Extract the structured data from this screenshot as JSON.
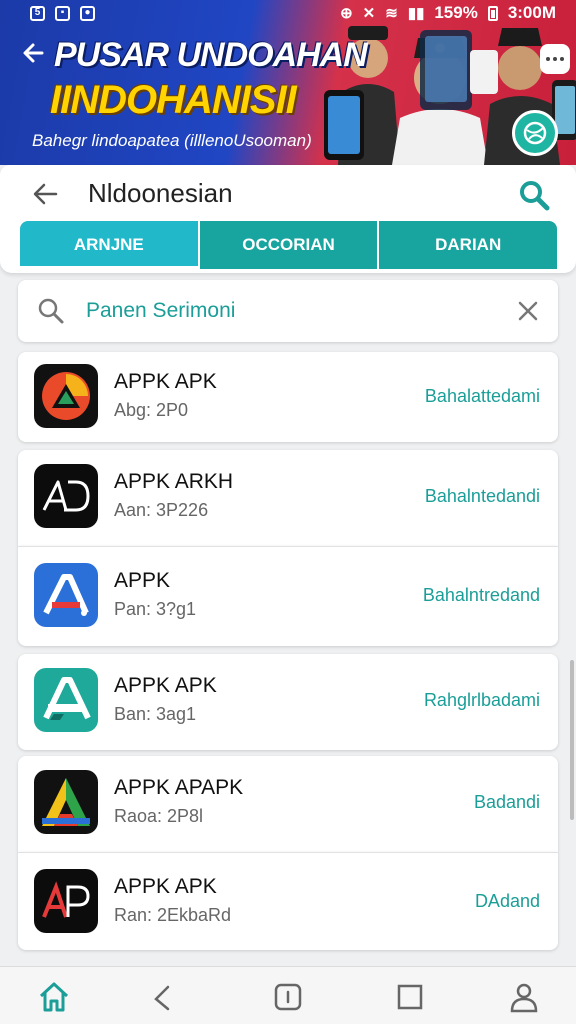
{
  "status_bar": {
    "left_icons": [
      "status-sim-icon",
      "gallery-icon",
      "messenger-icon"
    ],
    "battery_text": "159%",
    "time": "3:00M"
  },
  "banner": {
    "title": "PUSAR UNDOAHAN",
    "subtitle": "IINDOHANISII",
    "caption": "Bahegr lindoapatea (illlenoUsooman)"
  },
  "header": {
    "title": "Nldoonesian",
    "tabs": [
      {
        "label": "ARNJNE",
        "active": true
      },
      {
        "label": "OCCORIAN",
        "active": false
      },
      {
        "label": "DARIAN",
        "active": false
      }
    ]
  },
  "search": {
    "value": "Panen Serimoni"
  },
  "apps": [
    {
      "name": "APPK APK",
      "meta": "Abg: 2P0",
      "action": "Bahalattedami",
      "icon": "triangle-logo-icon"
    },
    {
      "name": "APPK ARKH",
      "meta": "Aan: 3P226",
      "action": "Bahalntedandi",
      "icon": "ad-logo-icon"
    },
    {
      "name": "APPK",
      "meta": "Pan: 3?g1",
      "action": "Bahalntredand",
      "icon": "blue-a-logo-icon"
    },
    {
      "name": "APPK APK",
      "meta": "Ban: 3ag1",
      "action": "Rahglrlbadami",
      "icon": "green-a-logo-icon"
    },
    {
      "name": "APPK APAPK",
      "meta": "Raoa: 2P8l",
      "action": "Badandi",
      "icon": "colorful-a-logo-icon"
    },
    {
      "name": "APPK APK",
      "meta": "Ran: 2EkbaRd",
      "action": "DAdand",
      "icon": "ap-logo-icon"
    }
  ],
  "colors": {
    "accent": "#1b9e98",
    "tab_primary": "#21b9c9",
    "tab_secondary": "#18a5a0"
  },
  "bottom_nav": [
    "home-icon",
    "back-gesture-icon",
    "recent-icon",
    "square-icon",
    "profile-icon"
  ]
}
